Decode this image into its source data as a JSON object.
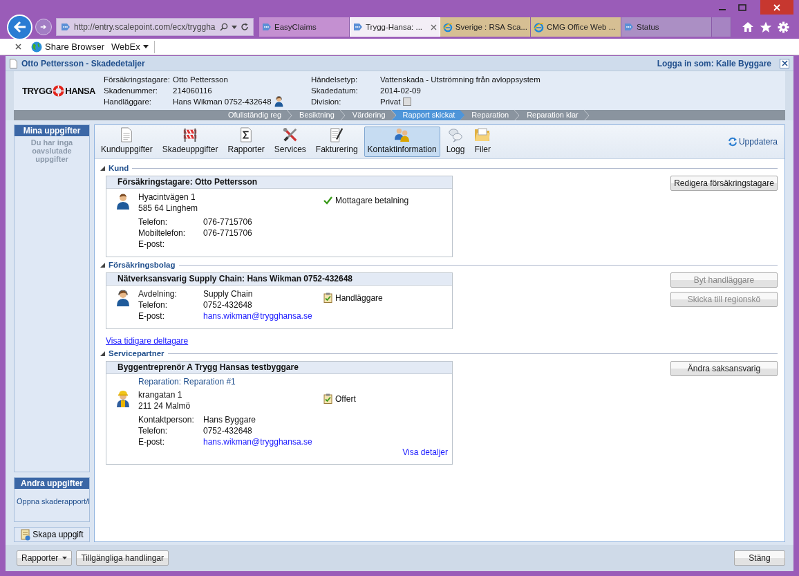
{
  "browser": {
    "address": "http://entry.scalepoint.com/ecx/tryggha",
    "tabs": [
      {
        "label": "EasyClaims",
        "selected": false,
        "kind": "page",
        "color": "#c490d1"
      },
      {
        "label": "Trygg-Hansa: ...",
        "selected": true,
        "kind": "page",
        "color": "#f3eef6"
      },
      {
        "label": "Sverige : RSA Sca...",
        "selected": false,
        "kind": "ie",
        "color": "#d6bf93"
      },
      {
        "label": "CMG Office Web ...",
        "selected": false,
        "kind": "ie",
        "color": "#d6bf93"
      },
      {
        "label": "Status",
        "selected": false,
        "kind": "page",
        "color": "#ab8fc4"
      }
    ],
    "favorites": [
      {
        "label": "Share Browser",
        "kind": "globe"
      },
      {
        "label": "WebEx",
        "kind": "menu"
      }
    ]
  },
  "app": {
    "title": "Otto Pettersson - Skadedetaljer",
    "login": "Logga in som: Kalle Byggare"
  },
  "logo": {
    "left": "TRYGG",
    "right": "HANSA"
  },
  "claim_fields": [
    {
      "label": "Försäkringstagare:",
      "value": "Otto Pettersson",
      "kind": "text"
    },
    {
      "label": "Skadenummer:",
      "value": "214060116",
      "kind": "text"
    },
    {
      "label": "Handläggare:",
      "value": "Hans Wikman 0752-432648",
      "kind": "person"
    },
    {
      "label": "Händelsetyp:",
      "value": "Vattenskada - Utströmning från avloppsystem",
      "kind": "text"
    },
    {
      "label": "Skadedatum:",
      "value": "2014-02-09",
      "kind": "text"
    },
    {
      "label": "Division:",
      "value": "Privat",
      "kind": "checkbox",
      "checked": false
    }
  ],
  "steps": [
    {
      "label": "Ofullständig reg",
      "selected": false
    },
    {
      "label": "Besiktning",
      "selected": false
    },
    {
      "label": "Värdering",
      "selected": false
    },
    {
      "label": "Rapport skickat",
      "selected": true
    },
    {
      "label": "Reparation",
      "selected": false
    },
    {
      "label": "Reparation klar",
      "selected": false
    }
  ],
  "sidebar": {
    "my_tasks": {
      "title": "Mina uppgifter",
      "empty": "Du har inga oavslutade uppgifter"
    },
    "other_tasks": {
      "title": "Andra uppgifter",
      "link": "Öppna skaderapport/l"
    },
    "create": "Skapa uppgift"
  },
  "toolbar": {
    "tabs": [
      {
        "label": "Kunduppgifter",
        "selected": false
      },
      {
        "label": "Skadeuppgifter",
        "selected": false
      },
      {
        "label": "Rapporter",
        "selected": false
      },
      {
        "label": "Services",
        "selected": false
      },
      {
        "label": "Fakturering",
        "selected": false
      },
      {
        "label": "Kontaktinformation",
        "selected": true
      },
      {
        "label": "Logg",
        "selected": false
      },
      {
        "label": "Filer",
        "selected": false
      }
    ],
    "refresh": "Uppdatera"
  },
  "sections": [
    {
      "title": "Kund",
      "card": {
        "heading": "Försäkringstagare: Otto Pettersson",
        "kind": "customer",
        "address": [
          "Hyacintvägen 1",
          "585 64 Linghem"
        ],
        "fields": [
          {
            "label": "Telefon:",
            "value": "076-7715706",
            "kind": "text"
          },
          {
            "label": "Mobiltelefon:",
            "value": "076-7715706",
            "kind": "text"
          },
          {
            "label": "E-post:"
          }
        ],
        "role": {
          "kind": "check",
          "label": "Mottagare betalning"
        }
      },
      "buttons": [
        {
          "label": "Redigera försäkringstagare",
          "disabled": false
        }
      ]
    },
    {
      "title": "Försäkringsbolag",
      "card": {
        "heading": "Nätverksansvarig Supply Chain: Hans Wikman 0752-432648",
        "kind": "agent",
        "fields": [
          {
            "label": "Avdelning:",
            "value": "Supply Chain",
            "kind": "text"
          },
          {
            "label": "Telefon:",
            "value": "0752-432648",
            "kind": "text"
          },
          {
            "label": "E-post:",
            "value": "hans.wikman@trygghansa.se",
            "kind": "email"
          }
        ],
        "role": {
          "kind": "clipboard",
          "label": "Handläggare"
        }
      },
      "link": "Visa tidigare deltagare",
      "buttons": [
        {
          "label": "Byt handläggare",
          "disabled": true
        },
        {
          "label": "Skicka till regionskö",
          "disabled": true
        }
      ]
    },
    {
      "title": "Servicepartner",
      "card": {
        "heading": "Byggentreprenör A Trygg Hansas testbyggare",
        "subtitle": "Reparation: Reparation #1",
        "kind": "builder",
        "address": [
          "krangatan 1",
          "211 24 Malmö"
        ],
        "fields": [
          {
            "label": "Kontaktperson:",
            "value": "Hans Byggare",
            "kind": "text"
          },
          {
            "label": "Telefon:",
            "value": "0752-432648",
            "kind": "text"
          },
          {
            "label": "E-post:",
            "value": "hans.wikman@trygghansa.se",
            "kind": "email"
          }
        ],
        "role": {
          "kind": "clipboard",
          "label": "Offert"
        },
        "link": "Visa detaljer"
      },
      "buttons": [
        {
          "label": "Ändra saksansvarig",
          "disabled": false
        }
      ]
    }
  ],
  "footer": {
    "buttons": [
      {
        "label": "Rapporter",
        "dropdown": true
      },
      {
        "label": "Tillgängliga handlingar",
        "dropdown": false
      }
    ],
    "close": "Stäng"
  }
}
